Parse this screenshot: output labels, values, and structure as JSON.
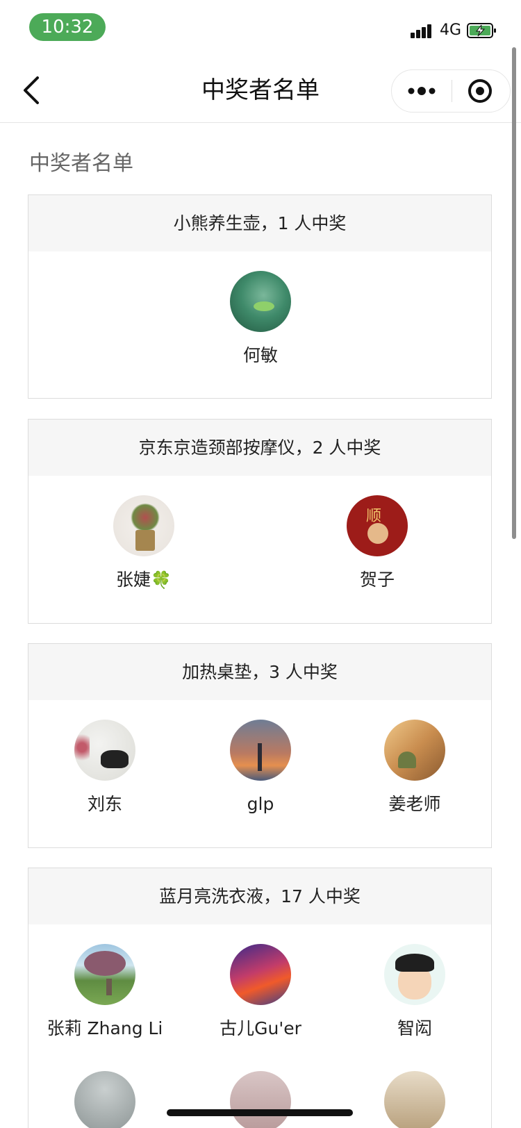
{
  "status_bar": {
    "time": "10:32",
    "network": "4G"
  },
  "nav": {
    "title": "中奖者名单",
    "back_icon": "chevron-left-icon",
    "more_icon": "more-dots-icon",
    "close_icon": "target-close-icon"
  },
  "heading": "中奖者名单",
  "prizes": [
    {
      "title": "小熊养生壶，1 人中奖",
      "winners": [
        {
          "name": "何敏"
        }
      ]
    },
    {
      "title": "京东京造颈部按摩仪，2 人中奖",
      "winners": [
        {
          "name": "张婕",
          "badge": "🍀"
        },
        {
          "name": "贺子",
          "avatar_text": "顺"
        }
      ]
    },
    {
      "title": "加热桌垫，3 人中奖",
      "winners": [
        {
          "name": "刘东"
        },
        {
          "name": "glp"
        },
        {
          "name": "姜老师"
        }
      ]
    },
    {
      "title": "蓝月亮洗衣液，17 人中奖",
      "winners": [
        {
          "name": "张莉 Zhang Li"
        },
        {
          "name": "古儿Gu'er"
        },
        {
          "name": "智闳"
        }
      ]
    }
  ]
}
